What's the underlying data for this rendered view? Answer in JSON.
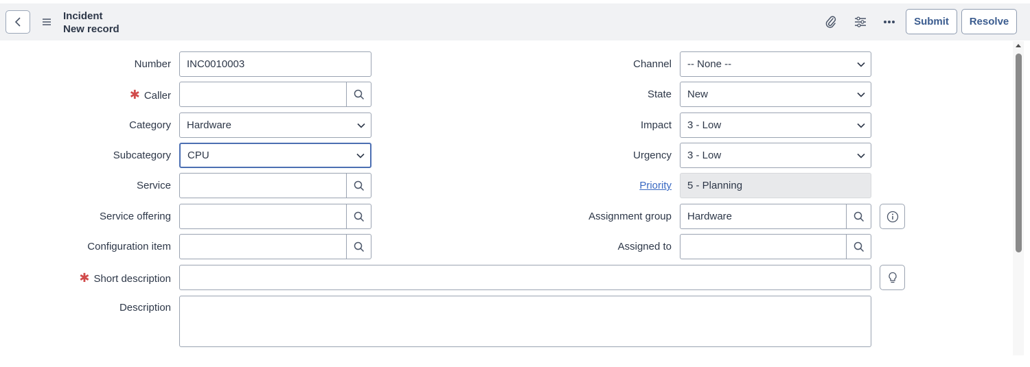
{
  "header": {
    "title": "Incident",
    "subtitle": "New record",
    "submit_label": "Submit",
    "resolve_label": "Resolve",
    "icons": [
      "chevron-left-icon",
      "hamburger-menu-icon",
      "paperclip-icon",
      "settings-sliders-icon",
      "more-ellipsis-icon"
    ]
  },
  "form": {
    "left": {
      "number": {
        "label": "Number",
        "value": "INC0010003"
      },
      "caller": {
        "label": "Caller",
        "value": "",
        "required": true
      },
      "category": {
        "label": "Category",
        "value": "Hardware"
      },
      "subcategory": {
        "label": "Subcategory",
        "value": "CPU"
      },
      "service": {
        "label": "Service",
        "value": ""
      },
      "service_offering": {
        "label": "Service offering",
        "value": ""
      },
      "configuration_item": {
        "label": "Configuration item",
        "value": ""
      }
    },
    "right": {
      "channel": {
        "label": "Channel",
        "value": "-- None --"
      },
      "state": {
        "label": "State",
        "value": "New"
      },
      "impact": {
        "label": "Impact",
        "value": "3 - Low"
      },
      "urgency": {
        "label": "Urgency",
        "value": "3 - Low"
      },
      "priority": {
        "label": "Priority",
        "value": "5 - Planning"
      },
      "assignment_group": {
        "label": "Assignment group",
        "value": "Hardware"
      },
      "assigned_to": {
        "label": "Assigned to",
        "value": ""
      }
    },
    "short_description": {
      "label": "Short description",
      "value": "",
      "required": true
    },
    "description": {
      "label": "Description",
      "value": ""
    },
    "required_marker": "✱"
  },
  "colors": {
    "header_bg": "#f1f2f4",
    "button_text": "#3b5c8f",
    "required": "#d14b4b",
    "link": "#3868c2",
    "focus_border": "#4c6fb2"
  }
}
